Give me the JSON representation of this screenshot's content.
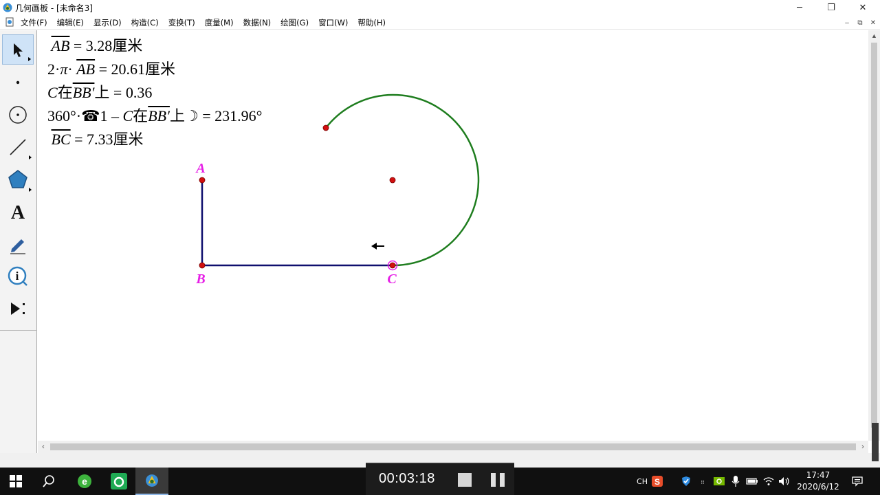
{
  "window": {
    "title": "几何画板 - [未命名3]",
    "controls": {
      "minimize": "─",
      "restore": "❐",
      "close": "✕"
    }
  },
  "menubar": {
    "items": [
      "文件(F)",
      "编辑(E)",
      "显示(D)",
      "构造(C)",
      "变换(T)",
      "度量(M)",
      "数据(N)",
      "绘图(G)",
      "窗口(W)",
      "帮助(H)"
    ],
    "mdi_controls": {
      "minimize": "–",
      "restore": "⧉",
      "close": "✕"
    }
  },
  "toolbox": {
    "tools": [
      {
        "name": "arrow-select-tool",
        "icon": "arrow-icon",
        "active": true
      },
      {
        "name": "point-tool",
        "icon": "point-icon",
        "active": false
      },
      {
        "name": "compass-tool",
        "icon": "circle-icon",
        "active": false
      },
      {
        "name": "straightedge-tool",
        "icon": "segment-icon",
        "active": false
      },
      {
        "name": "polygon-tool",
        "icon": "polygon-icon",
        "active": false
      },
      {
        "name": "text-tool",
        "icon": "text-icon",
        "active": false
      },
      {
        "name": "marker-tool",
        "icon": "pen-icon",
        "active": false
      },
      {
        "name": "information-tool",
        "icon": "info-icon",
        "active": false
      },
      {
        "name": "custom-tool",
        "icon": "play-dots-icon",
        "active": false
      }
    ],
    "text_tool_glyph": "A"
  },
  "measurements": {
    "m1": {
      "overline": "AB",
      "value": " = 3.28厘米"
    },
    "m2": {
      "prefix": "2·",
      "pi": "π",
      "dot": "· ",
      "overline": "AB",
      "value": " = 20.61厘米"
    },
    "m3": {
      "c": "C",
      "zai": "在",
      "overline": "BB′",
      "shang": "上",
      "value": " = 0.36"
    },
    "m4": {
      "prefix": "360°·",
      "sym1": "☎",
      "one": "1 – ",
      "c": "C",
      "zai": "在",
      "overline": "BB′",
      "shang": "上",
      "sym2": "☽",
      "value": " = 231.96°"
    },
    "m5": {
      "overline": "BC",
      "value": " = 7.33厘米"
    }
  },
  "points": {
    "A": "A",
    "B": "B",
    "C": "C"
  },
  "colors": {
    "label": "#e61ee6",
    "segment": "#0f0f6e",
    "arc": "#1e7d1e",
    "point": "#d11010",
    "tool_active": "#cfe3f7"
  },
  "recording": {
    "time": "00:03:18"
  },
  "taskbar": {
    "tray_lang": "CH",
    "clock_time": "17:47",
    "clock_date": "2020/6/12"
  }
}
